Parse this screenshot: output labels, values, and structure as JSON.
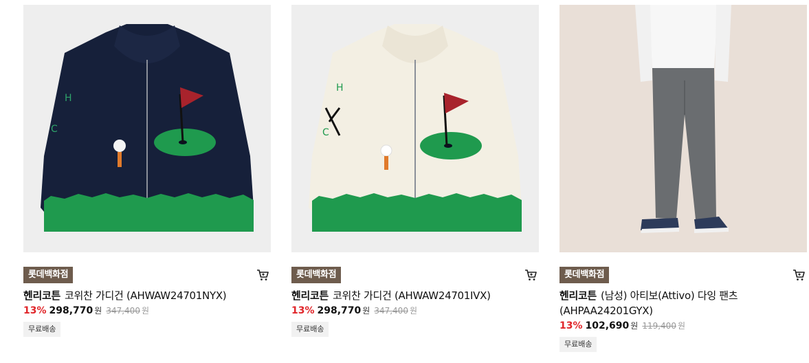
{
  "products": [
    {
      "store_badge": "롯데백화점",
      "brand": "헨리코튼",
      "name": "코위찬 가디건 (AHWAW24701NYX)",
      "discount": "13%",
      "price": "298,770",
      "currency": "원",
      "original_price": "347,400",
      "original_currency": "원",
      "shipping": "무료배송",
      "image_icon": "navy-golf-cardigan-image",
      "cart_icon": "cart-icon"
    },
    {
      "store_badge": "롯데백화점",
      "brand": "헨리코튼",
      "name": "코위찬 가디건 (AHWAW24701IVX)",
      "discount": "13%",
      "price": "298,770",
      "currency": "원",
      "original_price": "347,400",
      "original_currency": "원",
      "shipping": "무료배송",
      "image_icon": "ivory-golf-cardigan-image",
      "cart_icon": "cart-icon"
    },
    {
      "store_badge": "롯데백화점",
      "brand": "헨리코튼",
      "name": "(남성) 아티보(Attivo) 다잉 팬츠 (AHPAA24201GYX)",
      "discount": "13%",
      "price": "102,690",
      "currency": "원",
      "original_price": "119,400",
      "original_currency": "원",
      "shipping": "무료배송",
      "image_icon": "gray-pants-model-image",
      "cart_icon": "cart-icon"
    }
  ],
  "colors": {
    "badge_bg": "#6e5c4d",
    "discount": "#e0262a",
    "navy": "#16203a",
    "ivory": "#f3efe3",
    "green": "#1f9a4e"
  }
}
